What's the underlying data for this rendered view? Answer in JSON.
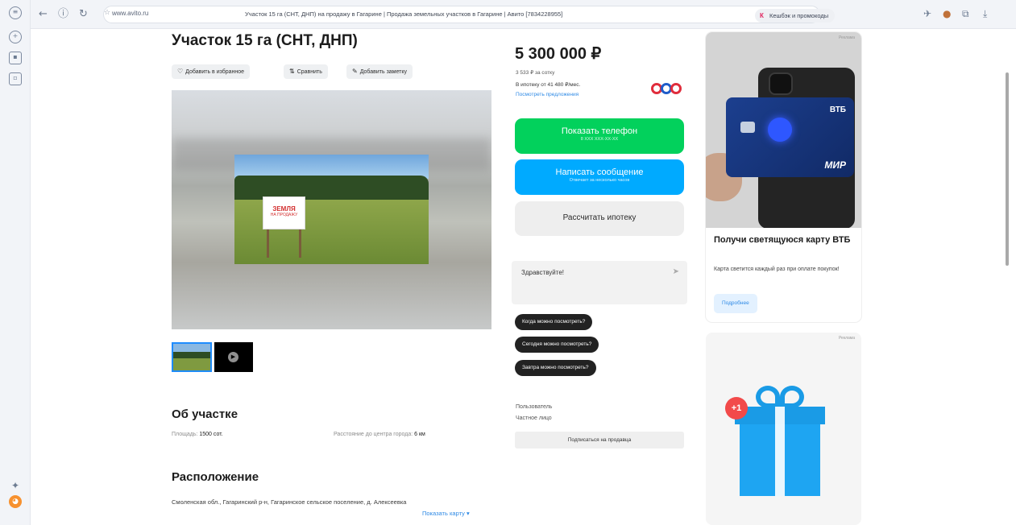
{
  "browser": {
    "url_domain": "www.avito.ru",
    "tab_title": "Участок 15 га (СНТ, ДНП) на продажу в Гагарине | Продажа земельных участков в Гагарине | Авито [7834228955]",
    "cashback_label": "Кешбэк и промокоды",
    "cashback_icon": "К"
  },
  "listing": {
    "title": "Участок 15 га (СНТ, ДНП)",
    "actions": {
      "favorite": "Добавить в избранное",
      "compare": "Сравнить",
      "note": "Добавить заметку"
    },
    "sign_text": "ЗЕМЛЯ",
    "sign_sub": "НА ПРОДАЖУ",
    "about_heading": "Об участке",
    "area_label": "Площадь:",
    "area_value": "1500 сот.",
    "distance_label": "Расстояние до центра города:",
    "distance_value": "6 км",
    "location_heading": "Расположение",
    "address": "Смоленская обл., Гагаринский р-н, Гагаринское сельское поселение, д. Алексеевка",
    "show_map": "Показать карту ▾"
  },
  "sidebar": {
    "price": "5 300 000 ₽",
    "price_per_unit": "3 533 ₽ за сотку",
    "mortgage_text": "В ипотеку от 41 480 ₽/мес.",
    "mortgage_link": "Посмотреть предложения",
    "show_phone": "Показать телефон",
    "show_phone_sub": "8 XXX XXX-XX-XX",
    "write_message": "Написать сообщение",
    "write_message_sub": "Отвечает за несколько часов",
    "calc_mortgage": "Рассчитать ипотеку",
    "chat_placeholder": "Здравствуйте!",
    "quick_questions": [
      "Когда можно посмотреть?",
      "Сегодня можно посмотреть?",
      "Завтра можно посмотреть?"
    ],
    "seller_name": "Пользователь",
    "seller_type": "Частное лицо",
    "subscribe": "Подписаться на продавца"
  },
  "ads": {
    "tag": "Реклама",
    "vtb_title": "Получи светящуюся карту ВТБ",
    "vtb_text": "Карта светится каждый раз при оплате покупок!",
    "vtb_button": "Подробнее",
    "card_brand": "ВТБ",
    "card_network": "МИР",
    "badge": "+1"
  }
}
